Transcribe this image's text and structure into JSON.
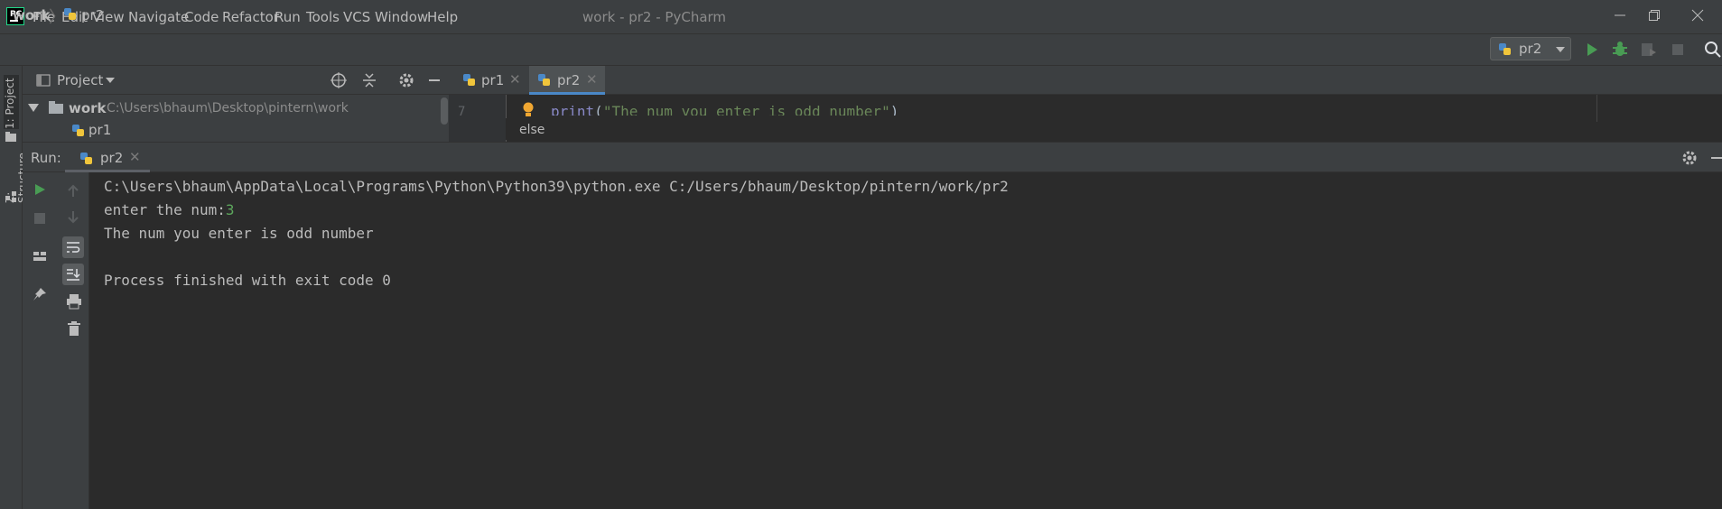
{
  "app": {
    "logo_text": "PC",
    "menu": [
      "File",
      "Edit",
      "View",
      "Navigate",
      "Code",
      "Refactor",
      "Run",
      "Tools",
      "VCS",
      "Window",
      "Help"
    ],
    "window_title": "work - pr2 - PyCharm"
  },
  "navbar": {
    "breadcrumb_project": "work",
    "breadcrumb_file": "pr2",
    "run_config": "pr2"
  },
  "left_strip": {
    "project_tab": "1: Project",
    "structure_tab": "Z: Structure"
  },
  "project": {
    "title": "Project",
    "root_name": "work",
    "root_path": "C:\\Users\\bhaum\\Desktop\\pintern\\work",
    "files": [
      "pr1"
    ]
  },
  "editor": {
    "tabs": [
      {
        "label": "pr1",
        "active": false
      },
      {
        "label": "pr2",
        "active": true
      }
    ],
    "line_number": "7",
    "code_keyword": "print",
    "code_string": "\"The num you enter is odd number\"",
    "completion_popup": "else"
  },
  "run": {
    "label": "Run:",
    "tab": "pr2",
    "console": {
      "command": "C:\\Users\\bhaum\\AppData\\Local\\Programs\\Python\\Python39\\python.exe C:/Users/bhaum/Desktop/pintern/work/pr2",
      "prompt": "enter the num:",
      "user_input": "3",
      "output": "The num you enter is odd number",
      "exit_message": "Process finished with exit code 0"
    }
  },
  "colors": {
    "accent_tab": "#4a88c7",
    "run_green": "#499c54",
    "input_green": "#5da75d",
    "background": "#2b2b2b",
    "panel": "#3c3f41"
  }
}
